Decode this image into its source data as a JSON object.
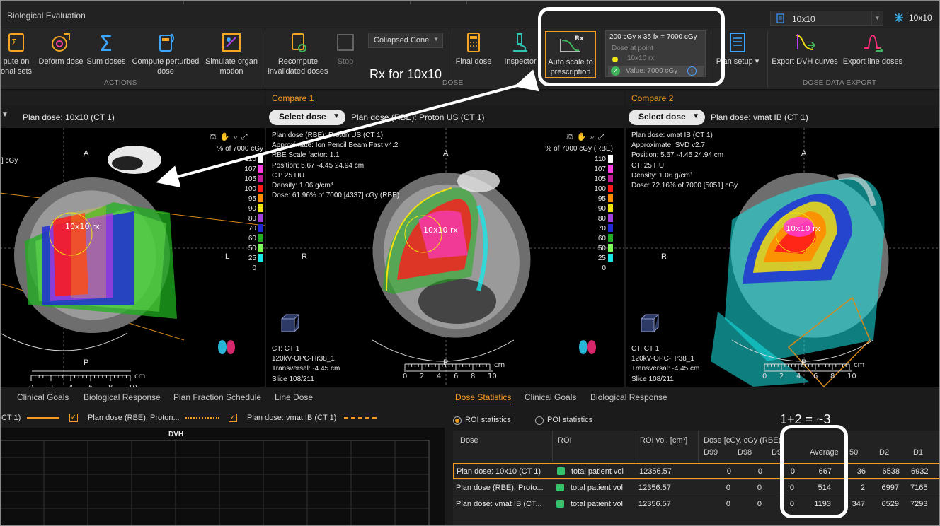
{
  "app": {
    "title": "Biological Evaluation",
    "plan_selector": "10x10",
    "beam_indicator": "10x10"
  },
  "ribbon": {
    "buttons": [
      {
        "id": "compute-on",
        "label_1": "pute on",
        "label_2": "onal sets"
      },
      {
        "id": "deform",
        "label_1": "Deform dose",
        "label_2": ""
      },
      {
        "id": "sum",
        "label_1": "Sum doses",
        "label_2": ""
      },
      {
        "id": "perturbed",
        "label_1": "Compute perturbed",
        "label_2": "dose"
      },
      {
        "id": "organ",
        "label_1": "Simulate organ",
        "label_2": "motion"
      },
      {
        "id": "recompute",
        "label_1": "Recompute",
        "label_2": "invalidated doses"
      },
      {
        "id": "stop",
        "label_1": "Stop",
        "label_2": ""
      },
      {
        "id": "final",
        "label_1": "Final dose",
        "label_2": ""
      },
      {
        "id": "inspector",
        "label_1": "Inspector",
        "label_2": ""
      },
      {
        "id": "plan-setup",
        "label_1": "Plan setup ▾",
        "label_2": ""
      },
      {
        "id": "export-dvh",
        "label_1": "Export DVH curves",
        "label_2": ""
      },
      {
        "id": "export-line",
        "label_1": "Export line doses",
        "label_2": ""
      }
    ],
    "algorithm": "Collapsed Cone",
    "auto_scale": {
      "label_1": "Auto scale to",
      "label_2": "prescription",
      "rx_glyph": "Rx"
    },
    "rx_panel": {
      "title": "200 cGy x 35 fx = 7000 cGy",
      "dose_at_point": "Dose at point",
      "rx_name": "10x10 rx",
      "value": "Value: 7000 cGy"
    },
    "groups": {
      "actions": "ACTIONS",
      "dose": "DOSE",
      "export": "DOSE DATA EXPORT"
    }
  },
  "viewports": [
    {
      "tab": "",
      "plan": "Plan dose: 10x10 (CT 1)",
      "info": [
        "",
        "",
        "",
        "",
        "",
        "",
        "] cGy"
      ],
      "legend_title": "% of 7000 cGy",
      "rx_label": "10x10 rx",
      "bottom_info": []
    },
    {
      "tab": "Compare 1",
      "select": "Select dose",
      "plan": "Plan dose (RBE): Proton US (CT 1)",
      "info": [
        "Plan dose (RBE): Proton US (CT 1)",
        "Approximate: Ion Pencil Beam Fast v4.2",
        "RBE Scale factor: 1.1",
        "",
        "Position: 5.67 -4.45 24.94 cm",
        "CT: 25 HU",
        "Density: 1.06 g/cm³",
        "Dose: 61.96% of 7000 [4337] cGy (RBE)"
      ],
      "legend_title": "% of 7000 cGy (RBE)",
      "rx_label": "10x10 rx",
      "bottom_info": [
        "CT: CT 1",
        "120kV-OPC-Hr38_1",
        "Transversal: -4.45 cm",
        "Slice 108/211"
      ]
    },
    {
      "tab": "Compare 2",
      "select": "Select dose",
      "plan": "Plan dose: vmat IB (CT 1)",
      "info": [
        "Plan dose: vmat IB (CT 1)",
        "Approximate: SVD v2.7",
        "",
        "Position: 5.67 -4.45 24.94 cm",
        "CT: 25 HU",
        "Density: 1.06 g/cm³",
        "Dose: 72.16% of 7000 [5051] cGy"
      ],
      "legend_title": "",
      "rx_label": "10x10 rx",
      "bottom_info": [
        "CT: CT 1",
        "120kV-OPC-Hr38_1",
        "Transversal: -4.45 cm",
        "Slice 108/211"
      ]
    }
  ],
  "orientation": {
    "anterior": "A",
    "posterior": "P",
    "right": "R",
    "left": "L"
  },
  "ruler": {
    "ticks": [
      "0",
      "2",
      "4",
      "6",
      "8",
      "10"
    ],
    "unit": "cm"
  },
  "isodose_legend": [
    {
      "level": "110",
      "color": "#ffffff"
    },
    {
      "level": "107",
      "color": "#ff3de0"
    },
    {
      "level": "105",
      "color": "#c41b9a"
    },
    {
      "level": "100",
      "color": "#ff1a1a"
    },
    {
      "level": "95",
      "color": "#ff8c00"
    },
    {
      "level": "90",
      "color": "#f4e20f"
    },
    {
      "level": "80",
      "color": "#a23de0"
    },
    {
      "level": "70",
      "color": "#1f2bd6"
    },
    {
      "level": "60",
      "color": "#1fb01f"
    },
    {
      "level": "50",
      "color": "#7dff5a"
    },
    {
      "level": "25",
      "color": "#19e6e6"
    },
    {
      "level": "0",
      "color": "#000000"
    }
  ],
  "lower_left": {
    "tabs": [
      "Clinical Goals",
      "Biological Response",
      "Plan Fraction Schedule",
      "Line Dose"
    ],
    "legend": [
      {
        "label": "CT 1)",
        "checked": false
      },
      {
        "label": "Plan dose (RBE): Proton...",
        "checked": true
      },
      {
        "label": "Plan dose: vmat IB (CT 1)",
        "checked": true
      }
    ],
    "chart_title": "DVH"
  },
  "lower_right": {
    "tabs": [
      "Dose Statistics",
      "Clinical Goals",
      "Biological Response"
    ],
    "radio_roi": "ROI statistics",
    "radio_poi": "POI statistics",
    "columns": {
      "dose": "Dose",
      "roi": "ROI",
      "roi_vol": "ROI vol. [cm³]",
      "dose_group": "Dose [cGy, cGy (RBE)]",
      "d99": "D99",
      "d98": "D98",
      "d95": "D9",
      "average": "Average",
      "d50": "50",
      "d2": "D2",
      "d1": "D1"
    },
    "rows": [
      {
        "dose": "Plan dose: 10x10 (CT 1)",
        "roi": "total patient vol",
        "vol": "12356.57",
        "d99": "0",
        "d98": "0",
        "d95": "0",
        "avg": "667",
        "d50": "36",
        "d2": "6538",
        "d1": "6932"
      },
      {
        "dose": "Plan dose (RBE): Proto...",
        "roi": "total patient vol",
        "vol": "12356.57",
        "d99": "0",
        "d98": "0",
        "d95": "0",
        "avg": "514",
        "d50": "2",
        "d2": "6997",
        "d1": "7165"
      },
      {
        "dose": "Plan dose: vmat IB (CT...",
        "roi": "total patient vol",
        "vol": "12356.57",
        "d99": "0",
        "d98": "0",
        "d95": "0",
        "avg": "1193",
        "d50": "347",
        "d2": "6529",
        "d1": "7293"
      }
    ]
  },
  "annotations": {
    "rx_note": "Rx for 10x10",
    "sum_note": "1+2 = ~3"
  }
}
